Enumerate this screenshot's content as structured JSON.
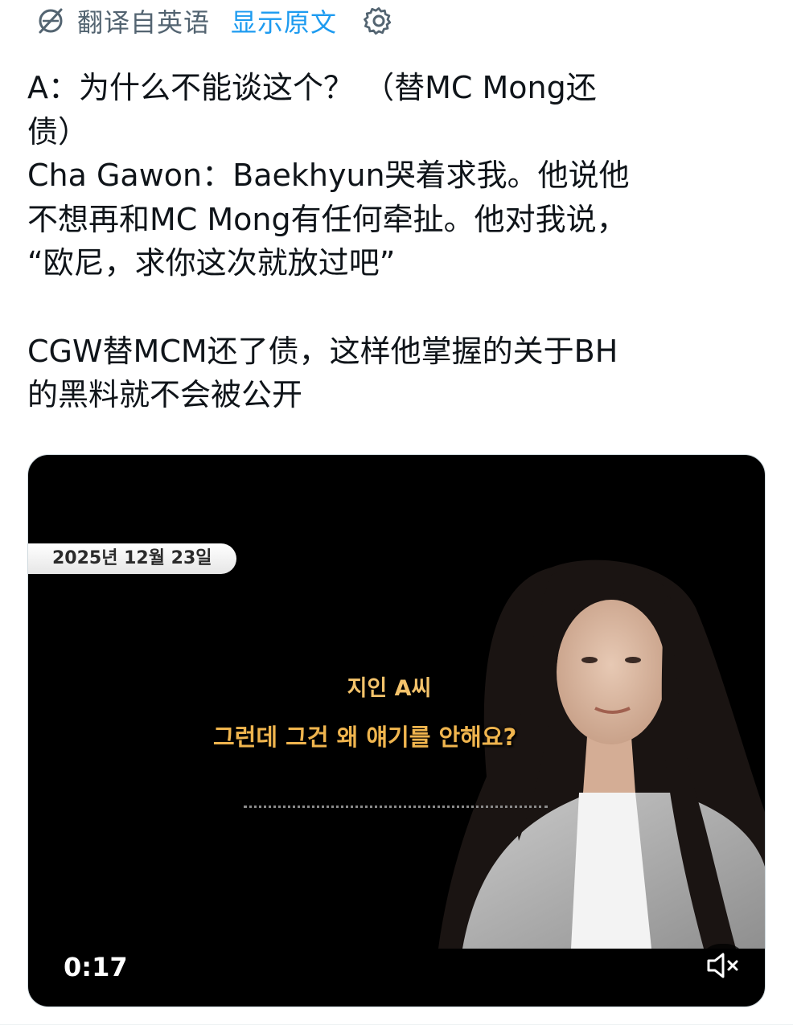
{
  "translation_bar": {
    "label": "翻译自英语",
    "show_original": "显示原文",
    "icon": "translate-icon",
    "settings_icon": "gear-icon"
  },
  "tweet": {
    "lines": [
      "A：为什么不能谈这个？ （替MC Mong还",
      "债）",
      "Cha Gawon：Baekhyun哭着求我。他说他",
      "不想再和MC Mong有任何牵扯。他对我说，",
      "“欧尼，求你这次就放过吧”",
      "",
      "CGW替MCM还了债，这样他掌握的关于BH",
      "的黑料就不会被公开"
    ]
  },
  "video": {
    "date_badge": "2025년 12월 23일",
    "subtitle_speaker": "지인 A씨",
    "subtitle_text": "그런데 그건 왜 얘기를 안해요?",
    "timestamp": "0:17",
    "mute_icon": "speaker-muted-icon"
  },
  "colors": {
    "accent": "#1d9bf0",
    "text": "#0f1419",
    "muted": "#536471",
    "subtitle": "#f0b54e"
  }
}
